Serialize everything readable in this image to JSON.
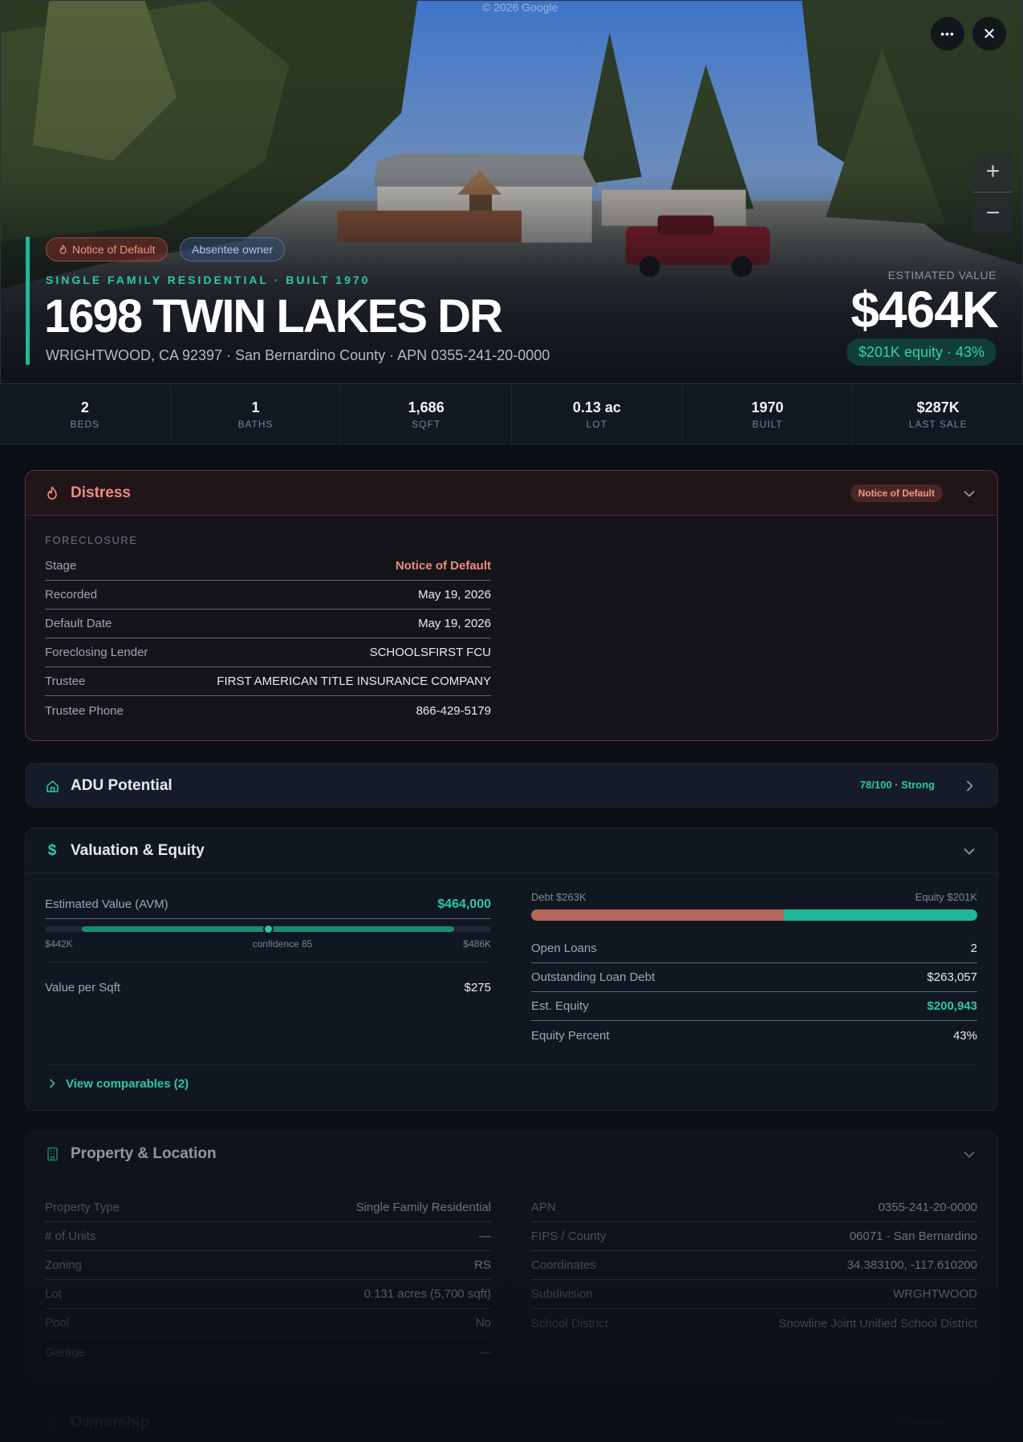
{
  "hero": {
    "watermark": "© 2026 Google",
    "tags": [
      "Notice of Default",
      "Absentee owner"
    ],
    "kicker": "SINGLE FAMILY RESIDENTIAL · BUILT 1970",
    "address": "1698 TWIN LAKES DR",
    "subaddress": "WRIGHTWOOD, CA 92397 · San Bernardino County · APN 0355-241-20-0000",
    "estimated_label": "ESTIMATED VALUE",
    "estimated_value": "$464K",
    "equity_pill": "$201K equity · 43%",
    "more_icon": "•••",
    "close_icon": "✕",
    "zoom_in": "+",
    "zoom_out": "−"
  },
  "stats": [
    {
      "value": "2",
      "label": "BEDS"
    },
    {
      "value": "1",
      "label": "BATHS"
    },
    {
      "value": "1,686",
      "label": "SQFT"
    },
    {
      "value": "0.13 ac",
      "label": "LOT"
    },
    {
      "value": "1970",
      "label": "BUILT"
    },
    {
      "value": "$287K",
      "label": "LAST SALE"
    }
  ],
  "distress": {
    "title": "Distress",
    "badge": "Notice of Default",
    "section": "FORECLOSURE",
    "rows": [
      {
        "k": "Stage",
        "v": "Notice of Default"
      },
      {
        "k": "Recorded",
        "v": "May 19, 2026"
      },
      {
        "k": "Default Date",
        "v": "May 19, 2026"
      },
      {
        "k": "Foreclosing Lender",
        "v": "SCHOOLSFIRST FCU"
      },
      {
        "k": "Trustee",
        "v": "FIRST AMERICAN TITLE INSURANCE COMPANY"
      },
      {
        "k": "Trustee Phone",
        "v": "866-429-5179"
      }
    ]
  },
  "adu": {
    "title": "ADU Potential",
    "score": "78/100 · Strong"
  },
  "valuation": {
    "title": "Valuation & Equity",
    "avm_label": "Estimated Value (AVM)",
    "avm_value": "$464,000",
    "avm_low": "$442K",
    "avm_high": "$486K",
    "avm_confidence": "confidence 85",
    "avm_range": {
      "min": 442000,
      "max": 486000,
      "value": 464000
    },
    "vps_label": "Value per Sqft",
    "vps_value": "$275",
    "debt_label": "Debt $263K",
    "equity_label": "Equity $201K",
    "debt_amount": 263057,
    "equity_amount": 200943,
    "rows": [
      {
        "k": "Open Loans",
        "v": "2"
      },
      {
        "k": "Outstanding Loan Debt",
        "v": "$263,057"
      },
      {
        "k": "Est. Equity",
        "v": "$200,943"
      },
      {
        "k": "Equity Percent",
        "v": "43%"
      }
    ],
    "comps_link": "View comparables (2)"
  },
  "property": {
    "title": "Property & Location",
    "left": [
      {
        "k": "Property Type",
        "v": "Single Family Residential"
      },
      {
        "k": "# of Units",
        "v": "—"
      },
      {
        "k": "Zoning",
        "v": "RS"
      },
      {
        "k": "Lot",
        "v": "0.131 acres (5,700 sqft)"
      },
      {
        "k": "Pool",
        "v": "No"
      },
      {
        "k": "Garage",
        "v": "—"
      }
    ],
    "right": [
      {
        "k": "APN",
        "v": "0355-241-20-0000"
      },
      {
        "k": "FIPS / County",
        "v": "06071 · San Bernardino"
      },
      {
        "k": "Coordinates",
        "v": "34.383100, -117.610200"
      },
      {
        "k": "Subdivision",
        "v": "WRGHTWOOD"
      },
      {
        "k": "School District",
        "v": "Snowline Joint Unified School District"
      }
    ]
  },
  "ownership": {
    "title": "Ownership",
    "badge": "Absentee"
  },
  "colors": {
    "accent": "#1fb99a",
    "distress": "#ef8d78",
    "debt": "#b5675b",
    "background": "#0b0f16"
  }
}
